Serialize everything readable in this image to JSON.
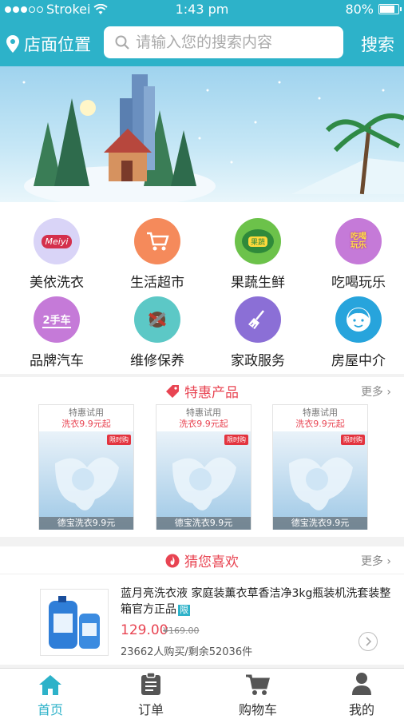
{
  "status_bar": {
    "carrier": "Strokei",
    "time": "1:43 pm",
    "battery": "80%",
    "battery_level": 0.8
  },
  "header": {
    "location_label": "店面位置",
    "search_placeholder": "请输入您的搜索内容",
    "search_button": "搜索"
  },
  "categories": [
    {
      "label": "美依洗衣",
      "icon": "meiyi-logo-icon",
      "color": "#d9d4f7",
      "icon_text": "Meiyi"
    },
    {
      "label": "生活超市",
      "icon": "shopping-cart-icon",
      "color": "#f58a5b"
    },
    {
      "label": "果蔬生鲜",
      "icon": "fruit-basket-icon",
      "color": "#6cc24a",
      "icon_text": "果蔬"
    },
    {
      "label": "吃喝玩乐",
      "icon": "food-fun-icon",
      "color": "#c57ad8",
      "icon_text": "吃喝玩乐"
    },
    {
      "label": "品牌汽车",
      "icon": "car-brand-icon",
      "color": "#c57ad8",
      "icon_text": "2手车"
    },
    {
      "label": "维修保养",
      "icon": "repair-tools-icon",
      "color": "#5cc8c6"
    },
    {
      "label": "家政服务",
      "icon": "broom-icon",
      "color": "#8b6fd6"
    },
    {
      "label": "房屋中介",
      "icon": "agent-face-icon",
      "color": "#27a4dc"
    }
  ],
  "special": {
    "title": "特惠产品",
    "more": "更多",
    "products": [
      {
        "top": "特惠试用",
        "sub": "洗衣9.9元起",
        "badge": "限时购",
        "caption": "德宝洗衣9.9元"
      },
      {
        "top": "特惠试用",
        "sub": "洗衣9.9元起",
        "badge": "限时购",
        "caption": "德宝洗衣9.9元"
      },
      {
        "top": "特惠试用",
        "sub": "洗衣9.9元起",
        "badge": "限时购",
        "caption": "德宝洗衣9.9元"
      }
    ]
  },
  "guess": {
    "title": "猜您喜欢",
    "more": "更多",
    "item": {
      "title": "蓝月亮洗衣液 家庭装薰衣草香洁净3kg瓶装机洗套装整箱官方正品",
      "tag": "限",
      "price": "129.00",
      "old_price": "¥169.00",
      "sales": "23662人购买/剩余52036件"
    }
  },
  "tabs": [
    {
      "label": "首页",
      "icon": "home-icon",
      "active": true
    },
    {
      "label": "订单",
      "icon": "order-clipboard-icon",
      "active": false
    },
    {
      "label": "购物车",
      "icon": "cart-icon",
      "active": false
    },
    {
      "label": "我的",
      "icon": "user-icon",
      "active": false
    }
  ],
  "colors": {
    "accent": "#2db2c9",
    "price_red": "#e84452"
  }
}
